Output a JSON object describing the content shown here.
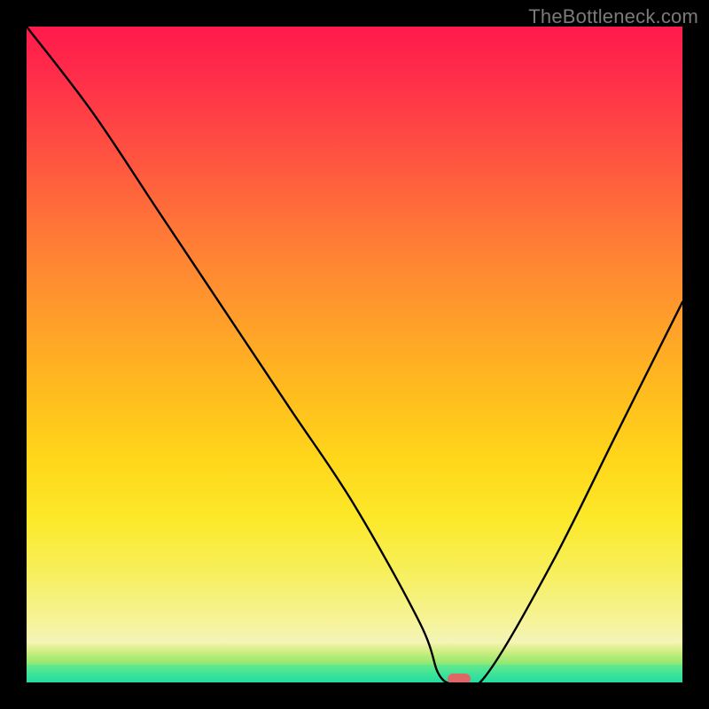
{
  "watermark": "TheBottleneck.com",
  "chart_data": {
    "type": "line",
    "title": "",
    "xlabel": "",
    "ylabel": "",
    "xlim": [
      0,
      100
    ],
    "ylim": [
      0,
      100
    ],
    "grid": false,
    "series": [
      {
        "name": "bottleneck-curve",
        "x": [
          0,
          10,
          20,
          30,
          40,
          50,
          60,
          63,
          66,
          70,
          80,
          90,
          100
        ],
        "y": [
          100,
          87,
          72,
          57,
          42,
          27,
          9,
          1,
          0,
          1,
          18,
          38,
          58
        ]
      }
    ],
    "marker": {
      "x": 66,
      "y": 0,
      "color": "#e06666"
    },
    "background_gradient": {
      "orientation": "vertical",
      "stops": [
        {
          "pos": 0.0,
          "color": "#ff1a4b"
        },
        {
          "pos": 0.5,
          "color": "#ffb020"
        },
        {
          "pos": 0.85,
          "color": "#f5f070"
        },
        {
          "pos": 0.95,
          "color": "#a7ea78"
        },
        {
          "pos": 1.0,
          "color": "#24dca0"
        }
      ]
    }
  }
}
